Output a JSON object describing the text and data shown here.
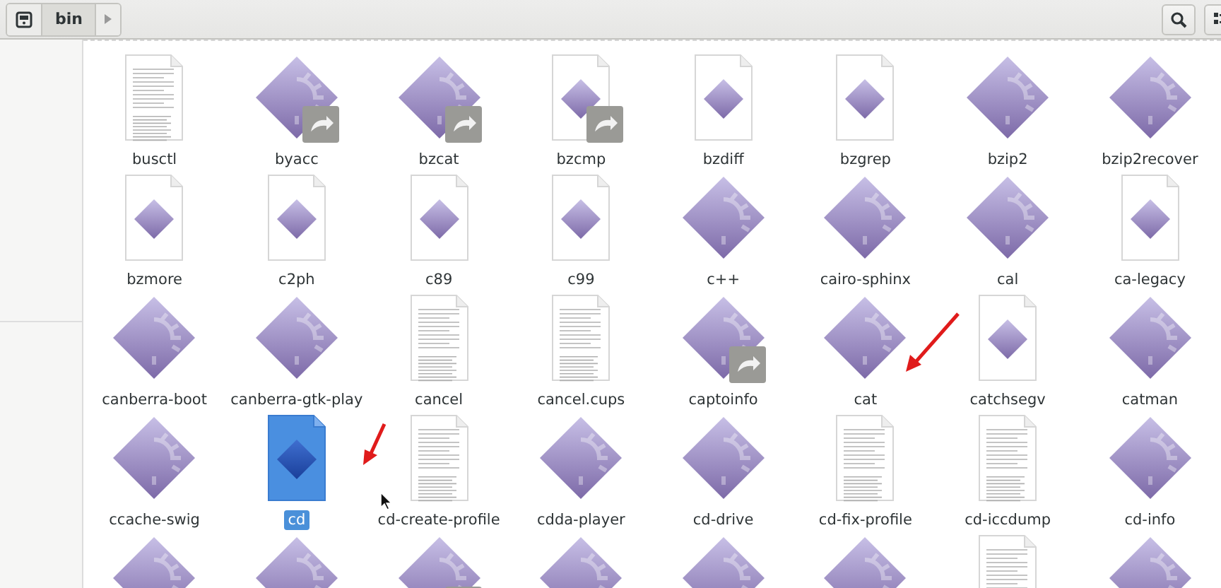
{
  "toolbar": {
    "path": [
      {
        "label": "bin",
        "selected": true
      }
    ]
  },
  "files": [
    {
      "name": "busctl",
      "kind": "text",
      "link": false,
      "selected": false
    },
    {
      "name": "byacc",
      "kind": "exec",
      "link": true,
      "selected": false
    },
    {
      "name": "bzcat",
      "kind": "exec",
      "link": true,
      "selected": false
    },
    {
      "name": "bzcmp",
      "kind": "script",
      "link": true,
      "selected": false
    },
    {
      "name": "bzdiff",
      "kind": "script",
      "link": false,
      "selected": false
    },
    {
      "name": "bzgrep",
      "kind": "script",
      "link": false,
      "selected": false
    },
    {
      "name": "bzip2",
      "kind": "exec",
      "link": false,
      "selected": false
    },
    {
      "name": "bzip2recover",
      "kind": "exec",
      "link": false,
      "selected": false
    },
    {
      "name": "bzmore",
      "kind": "script",
      "link": false,
      "selected": false
    },
    {
      "name": "c2ph",
      "kind": "script",
      "link": false,
      "selected": false
    },
    {
      "name": "c89",
      "kind": "script",
      "link": false,
      "selected": false
    },
    {
      "name": "c99",
      "kind": "script",
      "link": false,
      "selected": false
    },
    {
      "name": "c++",
      "kind": "exec",
      "link": false,
      "selected": false
    },
    {
      "name": "cairo-sphinx",
      "kind": "exec",
      "link": false,
      "selected": false
    },
    {
      "name": "cal",
      "kind": "exec",
      "link": false,
      "selected": false
    },
    {
      "name": "ca-legacy",
      "kind": "script",
      "link": false,
      "selected": false
    },
    {
      "name": "canberra-boot",
      "kind": "exec",
      "link": false,
      "selected": false
    },
    {
      "name": "canberra-gtk-play",
      "kind": "exec",
      "link": false,
      "selected": false
    },
    {
      "name": "cancel",
      "kind": "text",
      "link": false,
      "selected": false
    },
    {
      "name": "cancel.cups",
      "kind": "text",
      "link": false,
      "selected": false
    },
    {
      "name": "captoinfo",
      "kind": "exec",
      "link": true,
      "selected": false
    },
    {
      "name": "cat",
      "kind": "exec",
      "link": false,
      "selected": false
    },
    {
      "name": "catchsegv",
      "kind": "script",
      "link": false,
      "selected": false
    },
    {
      "name": "catman",
      "kind": "exec",
      "link": false,
      "selected": false
    },
    {
      "name": "ccache-swig",
      "kind": "exec",
      "link": false,
      "selected": false
    },
    {
      "name": "cd",
      "kind": "script",
      "link": false,
      "selected": true
    },
    {
      "name": "cd-create-profile",
      "kind": "text",
      "link": false,
      "selected": false
    },
    {
      "name": "cdda-player",
      "kind": "exec",
      "link": false,
      "selected": false
    },
    {
      "name": "cd-drive",
      "kind": "exec",
      "link": false,
      "selected": false
    },
    {
      "name": "cd-fix-profile",
      "kind": "text",
      "link": false,
      "selected": false
    },
    {
      "name": "cd-iccdump",
      "kind": "text",
      "link": false,
      "selected": false
    },
    {
      "name": "cd-info",
      "kind": "exec",
      "link": false,
      "selected": false
    },
    {
      "kind": "exec",
      "link": false,
      "selected": false
    },
    {
      "kind": "exec",
      "link": false,
      "selected": false
    },
    {
      "kind": "exec",
      "link": true,
      "selected": false
    },
    {
      "kind": "exec",
      "link": false,
      "selected": false
    },
    {
      "kind": "exec",
      "link": false,
      "selected": false
    },
    {
      "kind": "exec",
      "link": false,
      "selected": false
    },
    {
      "kind": "text",
      "link": false,
      "selected": false
    },
    {
      "kind": "exec",
      "link": false,
      "selected": false
    }
  ]
}
